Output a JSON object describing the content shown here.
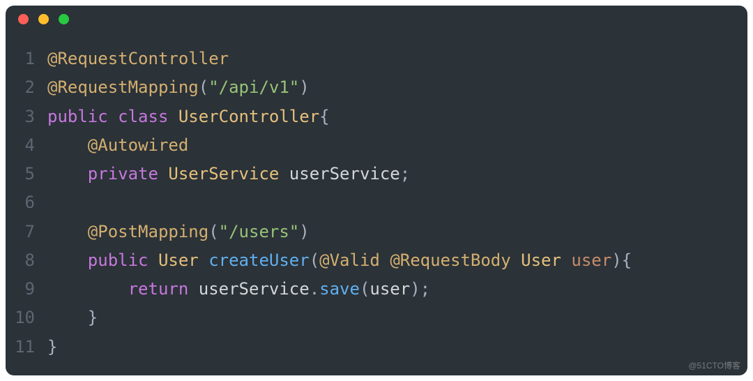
{
  "code": {
    "lines": [
      {
        "num": "1",
        "tokens": [
          {
            "cls": "tk-annotation",
            "text": "@RequestController"
          }
        ]
      },
      {
        "num": "2",
        "tokens": [
          {
            "cls": "tk-annotation",
            "text": "@RequestMapping"
          },
          {
            "cls": "tk-punct",
            "text": "("
          },
          {
            "cls": "tk-string",
            "text": "\"/api/v1\""
          },
          {
            "cls": "tk-punct",
            "text": ")"
          }
        ]
      },
      {
        "num": "3",
        "tokens": [
          {
            "cls": "tk-keyword",
            "text": "public"
          },
          {
            "cls": "tk-plain",
            "text": " "
          },
          {
            "cls": "tk-keyword",
            "text": "class"
          },
          {
            "cls": "tk-plain",
            "text": " "
          },
          {
            "cls": "tk-type",
            "text": "UserController"
          },
          {
            "cls": "tk-punct",
            "text": "{"
          }
        ]
      },
      {
        "num": "4",
        "tokens": [
          {
            "cls": "tk-plain",
            "text": "    "
          },
          {
            "cls": "tk-annotation",
            "text": "@Autowired"
          }
        ]
      },
      {
        "num": "5",
        "tokens": [
          {
            "cls": "tk-plain",
            "text": "    "
          },
          {
            "cls": "tk-keyword",
            "text": "private"
          },
          {
            "cls": "tk-plain",
            "text": " "
          },
          {
            "cls": "tk-type",
            "text": "UserService"
          },
          {
            "cls": "tk-plain",
            "text": " userService"
          },
          {
            "cls": "tk-punct",
            "text": ";"
          }
        ]
      },
      {
        "num": "6",
        "tokens": [
          {
            "cls": "tk-plain",
            "text": ""
          }
        ]
      },
      {
        "num": "7",
        "tokens": [
          {
            "cls": "tk-plain",
            "text": "    "
          },
          {
            "cls": "tk-annotation",
            "text": "@PostMapping"
          },
          {
            "cls": "tk-punct",
            "text": "("
          },
          {
            "cls": "tk-string",
            "text": "\"/users\""
          },
          {
            "cls": "tk-punct",
            "text": ")"
          }
        ]
      },
      {
        "num": "8",
        "tokens": [
          {
            "cls": "tk-plain",
            "text": "    "
          },
          {
            "cls": "tk-keyword",
            "text": "public"
          },
          {
            "cls": "tk-plain",
            "text": " "
          },
          {
            "cls": "tk-type",
            "text": "User"
          },
          {
            "cls": "tk-plain",
            "text": " "
          },
          {
            "cls": "tk-method",
            "text": "createUser"
          },
          {
            "cls": "tk-punct",
            "text": "("
          },
          {
            "cls": "tk-annotation",
            "text": "@Valid"
          },
          {
            "cls": "tk-plain",
            "text": " "
          },
          {
            "cls": "tk-annotation",
            "text": "@RequestBody"
          },
          {
            "cls": "tk-plain",
            "text": " "
          },
          {
            "cls": "tk-type",
            "text": "User"
          },
          {
            "cls": "tk-plain",
            "text": " "
          },
          {
            "cls": "tk-param",
            "text": "user"
          },
          {
            "cls": "tk-punct",
            "text": "){"
          }
        ]
      },
      {
        "num": "9",
        "tokens": [
          {
            "cls": "tk-plain",
            "text": "        "
          },
          {
            "cls": "tk-keyword",
            "text": "return"
          },
          {
            "cls": "tk-plain",
            "text": " userService"
          },
          {
            "cls": "tk-punct",
            "text": "."
          },
          {
            "cls": "tk-method",
            "text": "save"
          },
          {
            "cls": "tk-punct",
            "text": "("
          },
          {
            "cls": "tk-plain",
            "text": "user"
          },
          {
            "cls": "tk-punct",
            "text": ");"
          }
        ]
      },
      {
        "num": "10",
        "tokens": [
          {
            "cls": "tk-plain",
            "text": "    "
          },
          {
            "cls": "tk-punct",
            "text": "}"
          }
        ]
      },
      {
        "num": "11",
        "tokens": [
          {
            "cls": "tk-punct",
            "text": "}"
          }
        ]
      }
    ]
  },
  "watermark": "@51CTO博客"
}
